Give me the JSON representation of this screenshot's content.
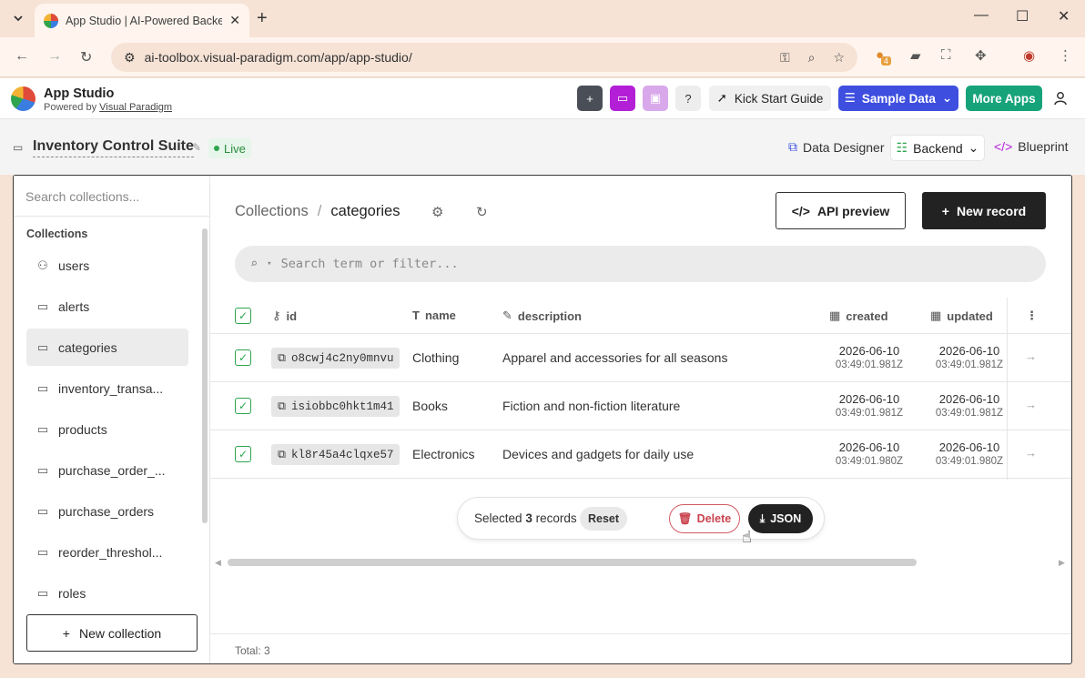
{
  "browser": {
    "tab_title": "App Studio | AI-Powered Backe",
    "url": "ai-toolbox.visual-paradigm.com/app/app-studio/",
    "ext_badge": "4"
  },
  "app": {
    "name": "App Studio",
    "powered_prefix": "Powered by",
    "powered_link": "Visual Paradigm",
    "kick_start": "Kick Start Guide",
    "sample_data": "Sample Data",
    "more_apps": "More Apps"
  },
  "project": {
    "name": "Inventory Control Suite",
    "status": "Live",
    "data_designer": "Data Designer",
    "backend": "Backend",
    "blueprint": "Blueprint"
  },
  "sidebar": {
    "search_placeholder": "Search collections...",
    "heading": "Collections",
    "items": [
      {
        "label": "users",
        "icon": "users-icon"
      },
      {
        "label": "alerts",
        "icon": "folder-icon"
      },
      {
        "label": "categories",
        "icon": "folder-icon",
        "active": true
      },
      {
        "label": "inventory_transa...",
        "icon": "folder-icon"
      },
      {
        "label": "products",
        "icon": "folder-icon"
      },
      {
        "label": "purchase_order_...",
        "icon": "folder-icon"
      },
      {
        "label": "purchase_orders",
        "icon": "folder-icon"
      },
      {
        "label": "reorder_threshol...",
        "icon": "folder-icon"
      },
      {
        "label": "roles",
        "icon": "folder-icon"
      }
    ],
    "new_collection": "New collection"
  },
  "main": {
    "crumb_root": "Collections",
    "crumb_sep": "/",
    "crumb_current": "categories",
    "api_preview": "API preview",
    "new_record": "New record",
    "filter_placeholder": "Search term or filter...",
    "columns": {
      "id": "id",
      "name": "name",
      "description": "description",
      "created": "created",
      "updated": "updated"
    },
    "rows": [
      {
        "id": "o8cwj4c2ny0mnvu",
        "name": "Clothing",
        "description": "Apparel and accessories for all seasons",
        "created_date": "2026-06-10",
        "created_time": "03:49:01.981Z",
        "updated_date": "2026-06-10",
        "updated_time": "03:49:01.981Z"
      },
      {
        "id": "isiobbc0hkt1m41",
        "name": "Books",
        "description": "Fiction and non-fiction literature",
        "created_date": "2026-06-10",
        "created_time": "03:49:01.981Z",
        "updated_date": "2026-06-10",
        "updated_time": "03:49:01.981Z"
      },
      {
        "id": "kl8r45a4clqxe57",
        "name": "Electronics",
        "description": "Devices and gadgets for daily use",
        "created_date": "2026-06-10",
        "created_time": "03:49:01.980Z",
        "updated_date": "2026-06-10",
        "updated_time": "03:49:01.980Z"
      }
    ],
    "selection": {
      "prefix": "Selected",
      "count": "3",
      "suffix": "records",
      "reset": "Reset",
      "delete": "Delete",
      "json": "JSON"
    },
    "total": "Total: 3"
  }
}
